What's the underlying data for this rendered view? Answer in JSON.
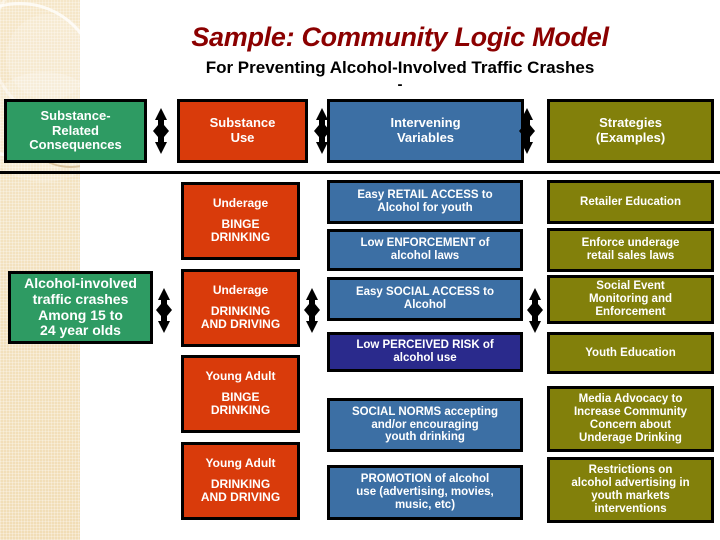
{
  "title": {
    "main": "Sample: Community Logic Model",
    "sub": "For Preventing Alcohol-Involved Traffic Crashes",
    "dash": "-"
  },
  "colors": {
    "title_main": "#8B0000",
    "consequences": "#2E9B63",
    "substance_use": "#D93B0B",
    "intervening": "#3C6FA4",
    "intervening_alt": "#2A2A8C",
    "strategies": "#82800B",
    "panel": "#F3E2C0",
    "outline": "#000000"
  },
  "headers": [
    {
      "id": "consequences",
      "lines": [
        "Substance-",
        "Related",
        "Consequences"
      ]
    },
    {
      "id": "substance_use",
      "lines": [
        "Substance",
        "Use"
      ]
    },
    {
      "id": "intervening",
      "lines": [
        "Intervening",
        "Variables"
      ]
    },
    {
      "id": "strategies",
      "lines": [
        "Strategies",
        "(Examples)"
      ]
    }
  ],
  "columns": {
    "consequences": [
      {
        "lines": [
          "Alcohol-involved",
          "traffic crashes"
        ],
        "lines2": [
          "Among 15 to",
          "24 year olds"
        ]
      }
    ],
    "substance_use": [
      {
        "lines": [
          "Underage"
        ],
        "lines2": [
          "BINGE",
          "DRINKING"
        ]
      },
      {
        "lines": [
          "Underage"
        ],
        "lines2": [
          "DRINKING",
          "AND DRIVING"
        ]
      },
      {
        "lines": [
          "Young Adult"
        ],
        "lines2": [
          "BINGE",
          "DRINKING"
        ]
      },
      {
        "lines": [
          "Young Adult"
        ],
        "lines2": [
          "DRINKING",
          "AND DRIVING"
        ]
      }
    ],
    "intervening": [
      {
        "lines": [
          "Easy RETAIL ACCESS to",
          "Alcohol for youth"
        ],
        "variant": "blue"
      },
      {
        "lines": [
          "Low ENFORCEMENT of",
          "alcohol laws"
        ],
        "variant": "blue"
      },
      {
        "lines": [
          "Easy SOCIAL ACCESS to",
          "Alcohol"
        ],
        "variant": "blue"
      },
      {
        "lines": [
          "Low PERCEIVED RISK of",
          "alcohol use"
        ],
        "variant": "navy"
      },
      {
        "lines": [
          "SOCIAL NORMS accepting",
          "and/or encouraging",
          "youth drinking"
        ],
        "variant": "blue"
      },
      {
        "lines": [
          "PROMOTION of alcohol",
          "use (advertising, movies,",
          "music, etc)"
        ],
        "variant": "blue"
      }
    ],
    "strategies": [
      {
        "lines": [
          "Retailer Education"
        ]
      },
      {
        "lines": [
          "Enforce underage",
          "retail sales laws"
        ]
      },
      {
        "lines": [
          "Social Event",
          "Monitoring and",
          "Enforcement"
        ]
      },
      {
        "lines": [
          "Youth Education"
        ]
      },
      {
        "lines": [
          "Media Advocacy to",
          "Increase Community",
          "Concern about",
          "Underage Drinking"
        ]
      },
      {
        "lines": [
          "Restrictions on",
          "alcohol advertising in",
          "youth markets",
          "interventions"
        ]
      }
    ]
  },
  "arrows": {
    "icon": "double-headed-vertical-arrow",
    "header_row": 3,
    "body_row": 3
  }
}
